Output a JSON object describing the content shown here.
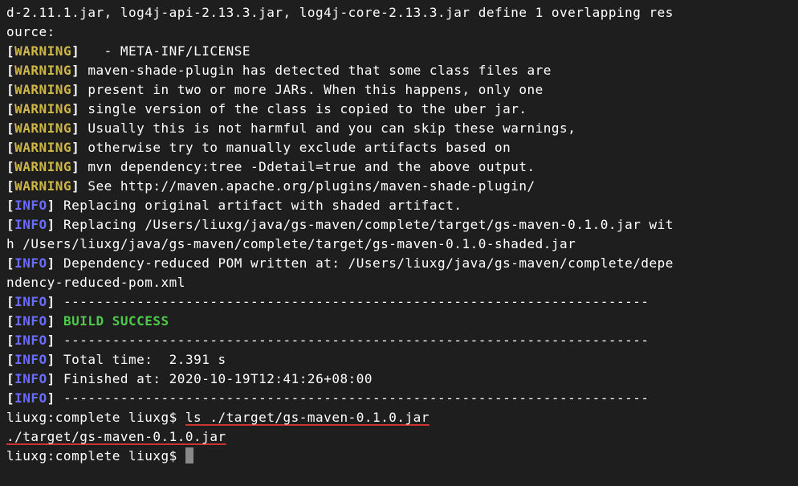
{
  "lines": {
    "overlap1": "d-2.11.1.jar, log4j-api-2.13.3.jar, log4j-core-2.13.3.jar define 1 overlapping res",
    "overlap2": "ource:",
    "warning_label": "WARNING",
    "info_label": "INFO",
    "warn1": "   - META-INF/LICENSE",
    "warn2": " maven-shade-plugin has detected that some class files are",
    "warn3": " present in two or more JARs. When this happens, only one",
    "warn4": " single version of the class is copied to the uber jar.",
    "warn5": " Usually this is not harmful and you can skip these warnings,",
    "warn6": " otherwise try to manually exclude artifacts based on",
    "warn7": " mvn dependency:tree -Ddetail=true and the above output.",
    "warn8": " See http://maven.apache.org/plugins/maven-shade-plugin/",
    "info1": " Replacing original artifact with shaded artifact.",
    "info2": " Replacing /Users/liuxg/java/gs-maven/complete/target/gs-maven-0.1.0.jar wit",
    "info2b": "h /Users/liuxg/java/gs-maven/complete/target/gs-maven-0.1.0-shaded.jar",
    "info3": " Dependency-reduced POM written at: /Users/liuxg/java/gs-maven/complete/depe",
    "info3b": "ndency-reduced-pom.xml",
    "separator": " ------------------------------------------------------------------------",
    "build_success": " BUILD SUCCESS",
    "total_time": " Total time:  2.391 s",
    "finished_at": " Finished at: 2020-10-19T12:41:26+08:00",
    "prompt1": "liuxg:complete liuxg$ ",
    "command": "ls ./target/gs-maven-0.1.0.jar",
    "output": "./target/gs-maven-0.1.0.jar",
    "prompt2": "liuxg:complete liuxg$ "
  }
}
